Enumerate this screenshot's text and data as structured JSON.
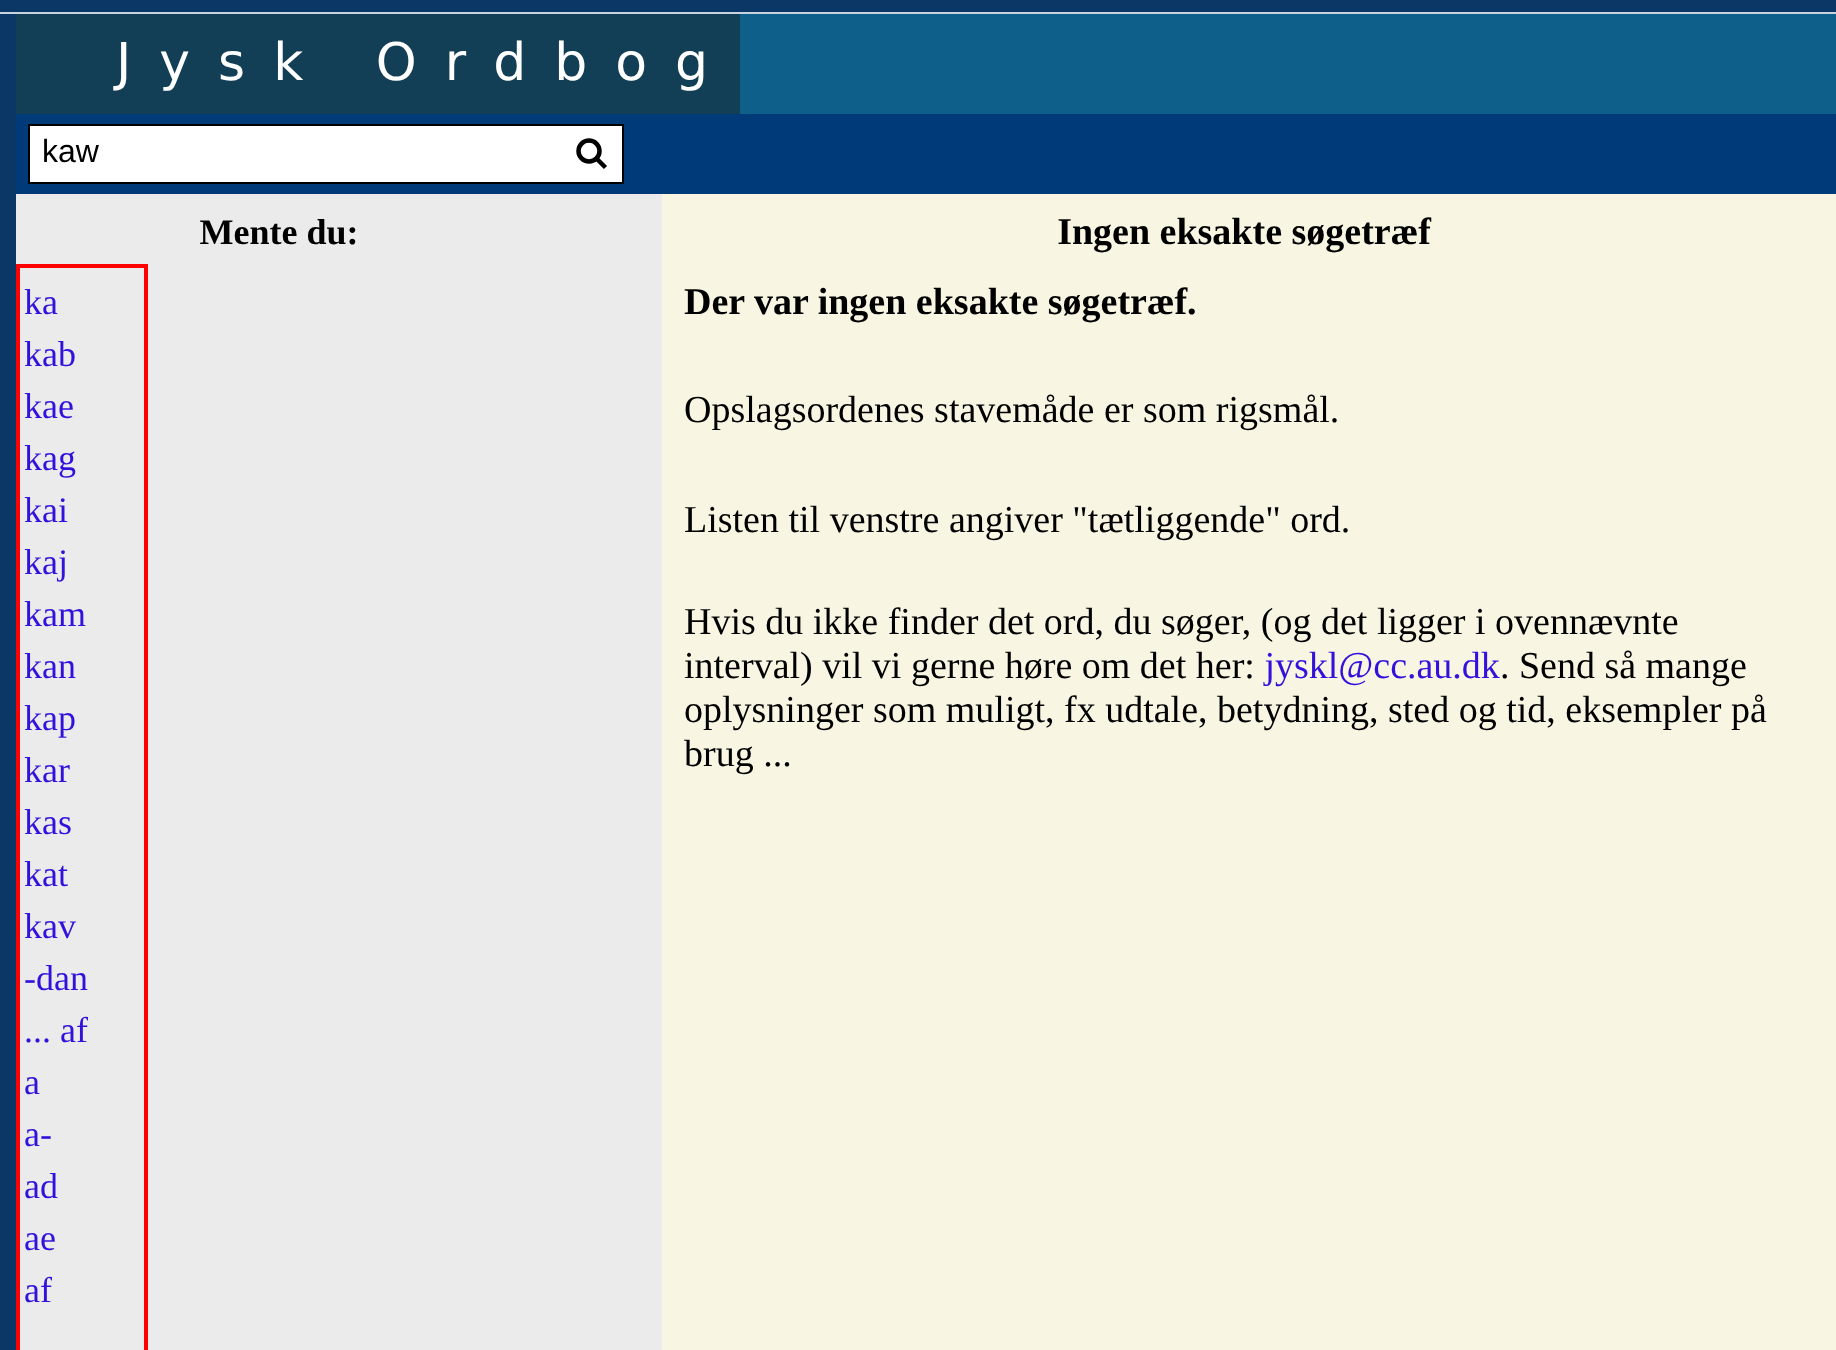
{
  "header": {
    "title": "Jysk Ordbog"
  },
  "search": {
    "value": "kaw"
  },
  "suggestions": {
    "heading": "Mente du:",
    "items": [
      "ka",
      "kab",
      "kae",
      "kag",
      "kai",
      "kaj",
      "kam",
      "kan",
      "kap",
      "kar",
      "kas",
      "kat",
      "kav",
      "-dan",
      "... af",
      "a",
      "a-",
      "ad",
      "ae",
      "af"
    ]
  },
  "result": {
    "heading": "Ingen eksakte søgetræf",
    "message": "Der var ingen eksakte søgetræf.",
    "paragraphs": [
      "Opslagsordenes stavemåde er som rigsmål.",
      "Listen til venstre angiver \"tætliggende\" ord."
    ],
    "contact": {
      "before": "Hvis du ikke finder det ord, du søger, (og det ligger i ovennævnte interval) vil vi gerne høre om det her: ",
      "link": "jyskl@cc.au.dk",
      "after": ". Send så mange oplysninger som muligt, fx udtale, betydning, sted og tid, eksempler på brug ..."
    }
  }
}
